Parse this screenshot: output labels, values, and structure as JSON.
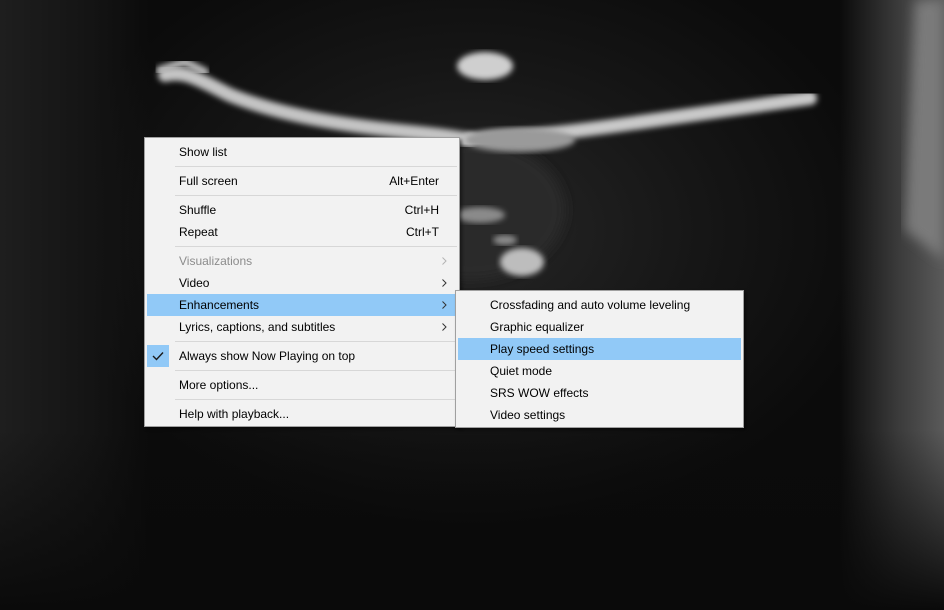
{
  "main_menu": {
    "items": [
      {
        "label": "Show list"
      },
      {
        "label": "Full screen",
        "shortcut": "Alt+Enter"
      },
      {
        "label": "Shuffle",
        "shortcut": "Ctrl+H"
      },
      {
        "label": "Repeat",
        "shortcut": "Ctrl+T"
      },
      {
        "label": "Visualizations"
      },
      {
        "label": "Video"
      },
      {
        "label": "Enhancements"
      },
      {
        "label": "Lyrics, captions, and subtitles"
      },
      {
        "label": "Always show Now Playing on top"
      },
      {
        "label": "More options..."
      },
      {
        "label": "Help with playback..."
      }
    ]
  },
  "enhancements_submenu": {
    "items": [
      {
        "label": "Crossfading and auto volume leveling"
      },
      {
        "label": "Graphic equalizer"
      },
      {
        "label": "Play speed settings"
      },
      {
        "label": "Quiet mode"
      },
      {
        "label": "SRS WOW effects"
      },
      {
        "label": "Video settings"
      }
    ]
  },
  "colors": {
    "menu_background": "#f2f2f2",
    "highlight": "#91c9f7",
    "disabled_text": "#8c8c8c",
    "separator": "#d7d7d7"
  },
  "icons": {
    "submenu_arrow": "chevron-right-icon",
    "checkmark": "check-icon"
  }
}
